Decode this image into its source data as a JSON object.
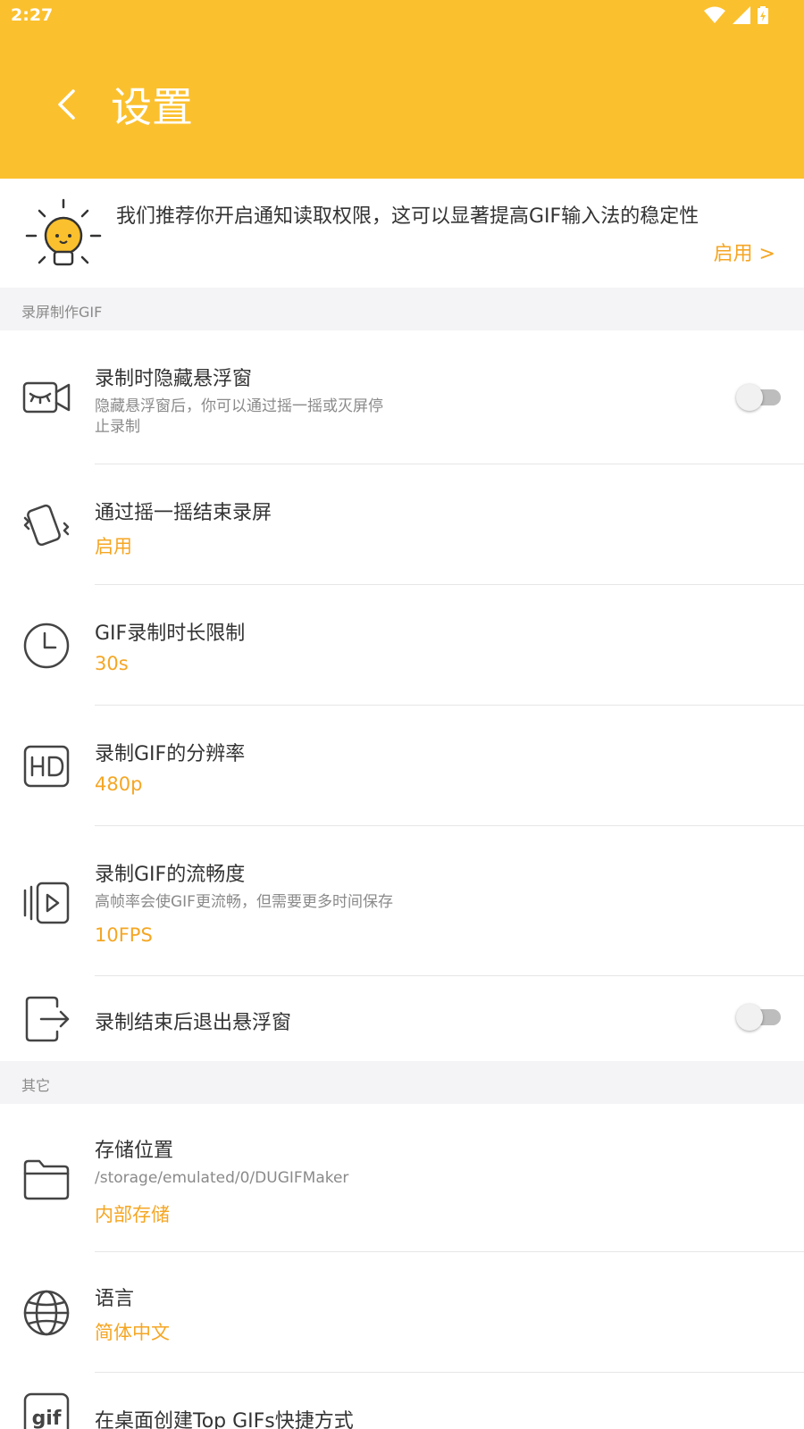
{
  "status_bar": {
    "time": "2:27"
  },
  "header": {
    "title": "设置"
  },
  "tip": {
    "text": "我们推荐你开启通知读取权限，这可以显著提高GIF输入法的稳定性",
    "link": "启用 >"
  },
  "sections": {
    "recording": {
      "header": "录屏制作GIF",
      "hide_window": {
        "title": "录制时隐藏悬浮窗",
        "desc_line1": "隐藏悬浮窗后，你可以通过摇一摇或灭屏停",
        "desc_line2": "止录制",
        "toggle_on": false
      },
      "shake_stop": {
        "title": "通过摇一摇结束录屏",
        "value": "启用"
      },
      "duration": {
        "title": "GIF录制时长限制",
        "value": "30s"
      },
      "resolution": {
        "title": "录制GIF的分辨率",
        "value": "480p"
      },
      "fps": {
        "title": "录制GIF的流畅度",
        "desc": "高帧率会使GIF更流畅，但需要更多时间保存",
        "value": "10FPS"
      },
      "exit_window": {
        "title": "录制结束后退出悬浮窗",
        "toggle_on": false
      }
    },
    "other": {
      "header": "其它",
      "storage": {
        "title": "存储位置",
        "path": "/storage/emulated/0/DUGIFMaker",
        "value": "内部存储"
      },
      "language": {
        "title": "语言",
        "value": "简体中文"
      },
      "shortcut": {
        "title": "在桌面创建Top GIFs快捷方式",
        "icon_text": "gif"
      }
    }
  },
  "colors": {
    "header": "#fbc02d",
    "accent": "#f5a623",
    "section_bg": "#f4f4f6"
  },
  "icons": {
    "back": "chevron-left-icon",
    "tip": "lightbulb-icon",
    "hide_window": "hidden-camera-icon",
    "shake": "shake-phone-icon",
    "duration": "clock-icon",
    "resolution": "hd-icon",
    "fps": "video-frames-icon",
    "exit": "exit-icon",
    "storage": "folder-icon",
    "language": "globe-icon",
    "shortcut": "gif-icon"
  }
}
